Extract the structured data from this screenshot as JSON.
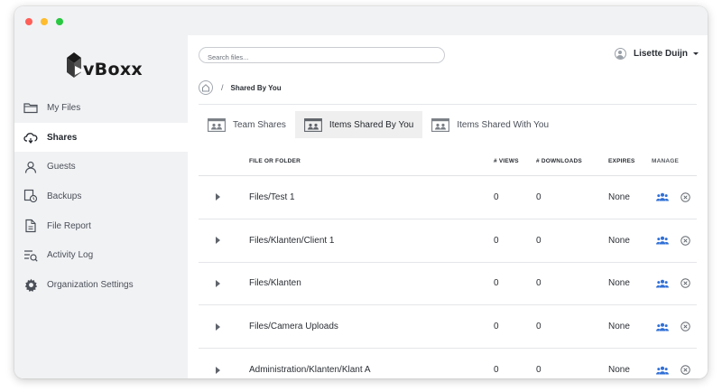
{
  "app": {
    "logo_text": "vBoxx"
  },
  "sidebar": {
    "items": [
      {
        "label": "My Files",
        "icon": "folder-icon",
        "active": false
      },
      {
        "label": "Shares",
        "icon": "cloud-share-icon",
        "active": true
      },
      {
        "label": "Guests",
        "icon": "user-icon",
        "active": false
      },
      {
        "label": "Backups",
        "icon": "backup-icon",
        "active": false
      },
      {
        "label": "File Report",
        "icon": "file-report-icon",
        "active": false
      },
      {
        "label": "Activity Log",
        "icon": "activity-log-icon",
        "active": false
      },
      {
        "label": "Organization Settings",
        "icon": "gear-icon",
        "active": false
      }
    ]
  },
  "header": {
    "search_placeholder": "Search files...",
    "user_name": "Lisette Duijn"
  },
  "breadcrumb": {
    "separator": "/",
    "current": "Shared By You"
  },
  "tabs": [
    {
      "label": "Team Shares",
      "active": false
    },
    {
      "label": "Items Shared By You",
      "active": true
    },
    {
      "label": "Items Shared With You",
      "active": false
    }
  ],
  "table": {
    "columns": {
      "name": "FILE OR FOLDER",
      "views": "# VIEWS",
      "downloads": "# DOWNLOADS",
      "expires": "EXPIRES",
      "manage": "MANAGE"
    },
    "rows": [
      {
        "name": "Files/Test 1",
        "views": "0",
        "downloads": "0",
        "expires": "None"
      },
      {
        "name": "Files/Klanten/Client 1",
        "views": "0",
        "downloads": "0",
        "expires": "None"
      },
      {
        "name": "Files/Klanten",
        "views": "0",
        "downloads": "0",
        "expires": "None"
      },
      {
        "name": "Files/Camera Uploads",
        "views": "0",
        "downloads": "0",
        "expires": "None"
      },
      {
        "name": "Administration/Klanten/Klant A",
        "views": "0",
        "downloads": "0",
        "expires": "None"
      }
    ]
  },
  "colors": {
    "accent_blue": "#2f6fd6",
    "sidebar_bg": "#f1f2f4",
    "active_tab_bg": "#efefef"
  }
}
